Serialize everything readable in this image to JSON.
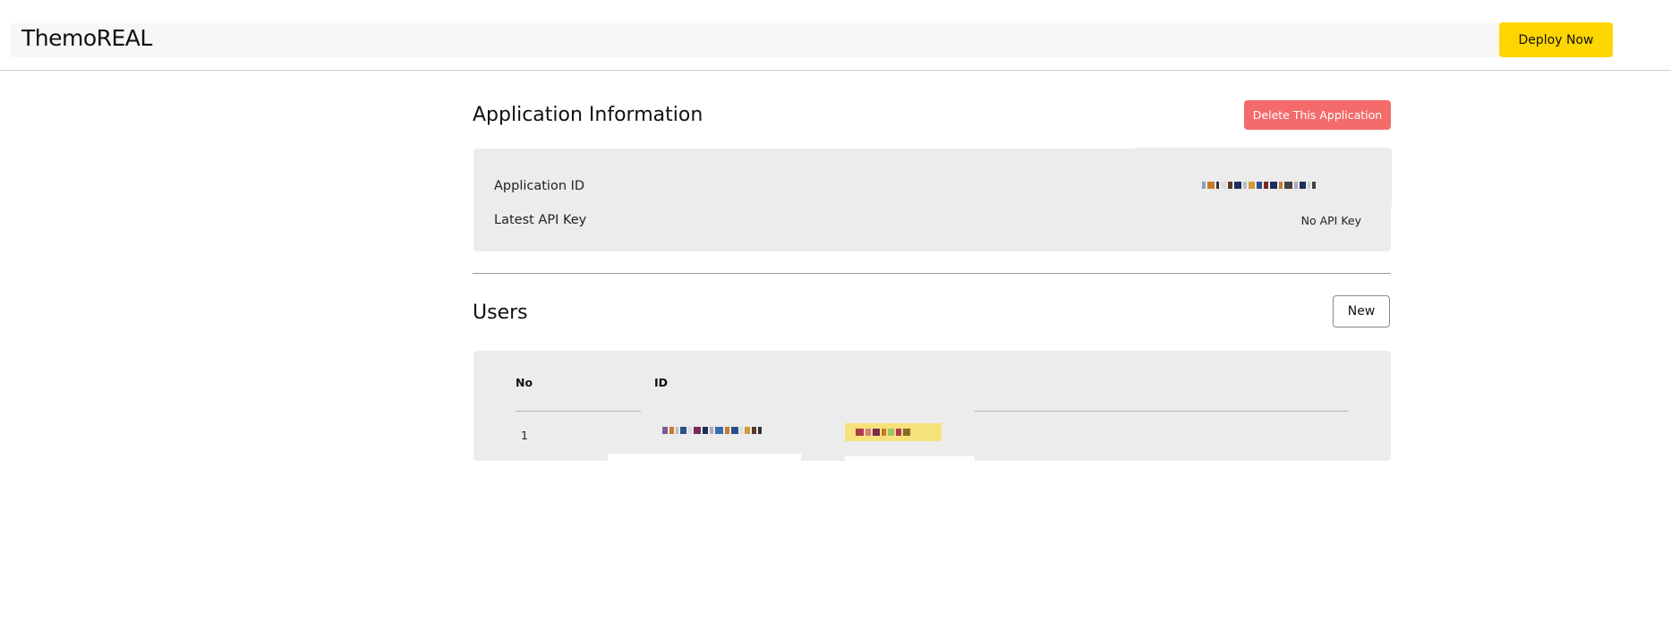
{
  "app": {
    "brand": "ThemoREAL",
    "deploy_label": "Deploy Now"
  },
  "application_info": {
    "title": "Application Information",
    "delete_label": "Delete This Application",
    "fields": [
      {
        "label": "Application ID",
        "value": ""
      },
      {
        "label": "Latest API Key",
        "value": "No API Key"
      }
    ]
  },
  "users": {
    "title": "Users",
    "new_label": "New",
    "columns": [
      "No",
      "ID"
    ],
    "rows": [
      {
        "no": "1",
        "id": ""
      }
    ]
  },
  "colors": {
    "deploy": "#ffd500",
    "delete": "#f36b6b",
    "card": "#ececec"
  }
}
